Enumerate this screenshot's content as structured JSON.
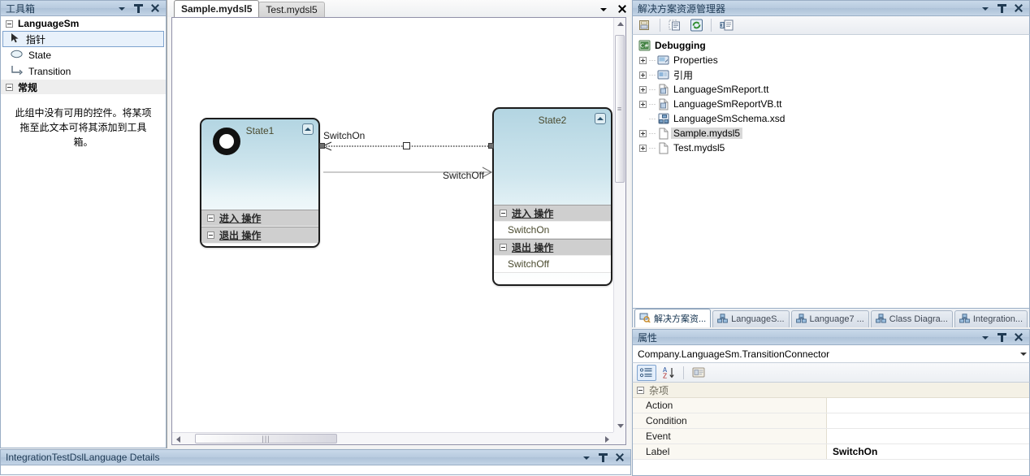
{
  "toolbox": {
    "title": "工具箱",
    "groups": [
      {
        "label": "LanguageSm",
        "items": [
          {
            "label": "指针",
            "icon": "pointer-icon",
            "selected": true
          },
          {
            "label": "State",
            "icon": "state-ellipse-icon",
            "selected": false
          },
          {
            "label": "Transition",
            "icon": "transition-arrow-icon",
            "selected": false
          }
        ]
      },
      {
        "label": "常规",
        "items": []
      }
    ],
    "empty_note": "此组中没有可用的控件。将某项拖至此文本可将其添加到工具箱。"
  },
  "document": {
    "tabs": [
      {
        "label": "Sample.mydsl5",
        "active": true
      },
      {
        "label": "Test.mydsl5",
        "active": false
      }
    ],
    "diagram": {
      "states": [
        {
          "name": "State1",
          "has_initial_marker": true,
          "compartments": [
            {
              "header": "进入 操作",
              "rows": []
            },
            {
              "header": "退出 操作",
              "rows": []
            }
          ]
        },
        {
          "name": "State2",
          "has_initial_marker": false,
          "compartments": [
            {
              "header": "进入 操作",
              "rows": [
                "SwitchOn"
              ]
            },
            {
              "header": "退出 操作",
              "rows": [
                "SwitchOff"
              ]
            }
          ]
        }
      ],
      "connectors": [
        {
          "label": "SwitchOn",
          "selected": true,
          "direction": "right-to-left"
        },
        {
          "label": "SwitchOff",
          "selected": false,
          "direction": "left-to-right"
        }
      ]
    }
  },
  "solution_explorer": {
    "title": "解决方案资源管理器",
    "toolbar": [
      {
        "icon": "properties-icon"
      },
      {
        "icon": "show-all-files-icon"
      },
      {
        "icon": "refresh-icon"
      },
      {
        "icon": "view-code-icon"
      }
    ],
    "tree": [
      {
        "label": "Debugging",
        "icon": "csharp-project-icon",
        "depth": 0,
        "expander": "none",
        "root": true,
        "selected": false
      },
      {
        "label": "Properties",
        "icon": "properties-folder-icon",
        "depth": 1,
        "expander": "plus",
        "root": false,
        "selected": false
      },
      {
        "label": "引用",
        "icon": "references-folder-icon",
        "depth": 1,
        "expander": "plus",
        "root": false,
        "selected": false
      },
      {
        "label": "LanguageSmReport.tt",
        "icon": "tt-file-icon",
        "depth": 1,
        "expander": "plus",
        "root": false,
        "selected": false
      },
      {
        "label": "LanguageSmReportVB.tt",
        "icon": "tt-file-icon",
        "depth": 1,
        "expander": "plus",
        "root": false,
        "selected": false
      },
      {
        "label": "LanguageSmSchema.xsd",
        "icon": "xsd-file-icon",
        "depth": 1,
        "expander": "none",
        "root": false,
        "selected": false
      },
      {
        "label": "Sample.mydsl5",
        "icon": "file-icon",
        "depth": 1,
        "expander": "plus",
        "root": false,
        "selected": true
      },
      {
        "label": "Test.mydsl5",
        "icon": "file-icon",
        "depth": 1,
        "expander": "plus",
        "root": false,
        "selected": false
      }
    ],
    "tabs": [
      {
        "label": "解决方案资...",
        "icon": "solution-explorer-icon",
        "active": true
      },
      {
        "label": "LanguageS...",
        "icon": "class-diagram-icon",
        "active": false
      },
      {
        "label": "Language7 ...",
        "icon": "class-diagram-icon",
        "active": false
      },
      {
        "label": "Class Diagra...",
        "icon": "class-diagram-icon",
        "active": false
      },
      {
        "label": "Integration...",
        "icon": "class-diagram-icon",
        "active": false
      }
    ]
  },
  "properties": {
    "title": "属性",
    "object": "Company.LanguageSm.TransitionConnector",
    "toolbar": [
      {
        "icon": "categorized-icon",
        "active": true
      },
      {
        "icon": "alphabetical-sort-icon",
        "active": false
      },
      {
        "icon": "property-pages-icon",
        "active": false
      }
    ],
    "category": "杂项",
    "rows": [
      {
        "name": "Action",
        "value": ""
      },
      {
        "name": "Condition",
        "value": ""
      },
      {
        "name": "Event",
        "value": ""
      },
      {
        "name": "Label",
        "value": "SwitchOn"
      }
    ]
  },
  "bottom_window": {
    "title": "IntegrationTestDslLanguage Details"
  },
  "colors": {
    "panel_title_bg": "#b8cbdf",
    "state_fill_top": "#b3d5e2",
    "selection_blue": "#7da2ce",
    "category_bg": "#f4f1e6"
  }
}
